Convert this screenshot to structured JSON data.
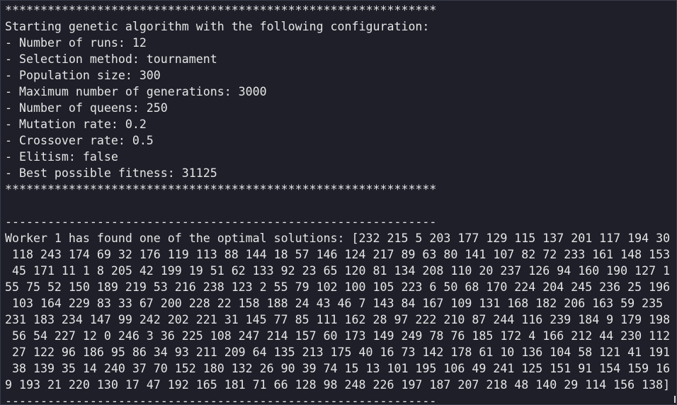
{
  "terminal": {
    "lines": [
      "*************************************************************",
      "Starting genetic algorithm with the following configuration:",
      "- Number of runs: 12",
      "- Selection method: tournament",
      "- Population size: 300",
      "- Maximum number of generations: 3000",
      "- Number of queens: 250",
      "- Mutation rate: 0.2",
      "- Crossover rate: 0.5",
      "- Elitism: false",
      "- Best possible fitness: 31125",
      "*************************************************************",
      "",
      "-------------------------------------------------------------",
      "Worker 1 has found one of the optimal solutions: [232 215 5 203 177 129 115 137 201 117 194 30",
      " 118 243 174 69 32 176 119 113 88 144 18 57 146 124 217 89 63 80 141 107 82 72 233 161 148 153",
      " 45 171 11 1 8 205 42 199 19 51 62 133 92 23 65 120 81 134 208 110 20 237 126 94 160 190 127 1",
      "55 75 52 150 189 219 53 216 238 123 2 55 79 102 100 105 223 6 50 68 170 224 204 245 236 25 196",
      " 103 164 229 83 33 67 200 228 22 158 188 24 43 46 7 143 84 167 109 131 168 182 206 163 59 235",
      "231 183 234 147 99 242 202 221 31 145 77 85 111 162 28 97 222 210 87 244 116 239 184 9 179 198",
      " 56 54 227 12 0 246 3 36 225 108 247 214 157 60 173 149 249 78 76 185 172 4 166 212 44 230 112",
      " 27 122 96 186 95 86 34 93 211 209 64 135 213 175 40 16 73 142 178 61 10 136 104 58 121 41 191",
      " 38 139 35 14 240 37 70 152 180 132 26 90 39 74 15 13 101 195 106 49 241 125 151 91 154 159 16",
      "9 193 21 220 130 17 47 192 165 181 71 66 128 98 248 226 197 187 207 218 48 140 29 114 156 138]",
      "-------------------------------------------------------------"
    ]
  },
  "colors": {
    "background": "#1e1f29",
    "foreground": "#e6e6e6"
  }
}
